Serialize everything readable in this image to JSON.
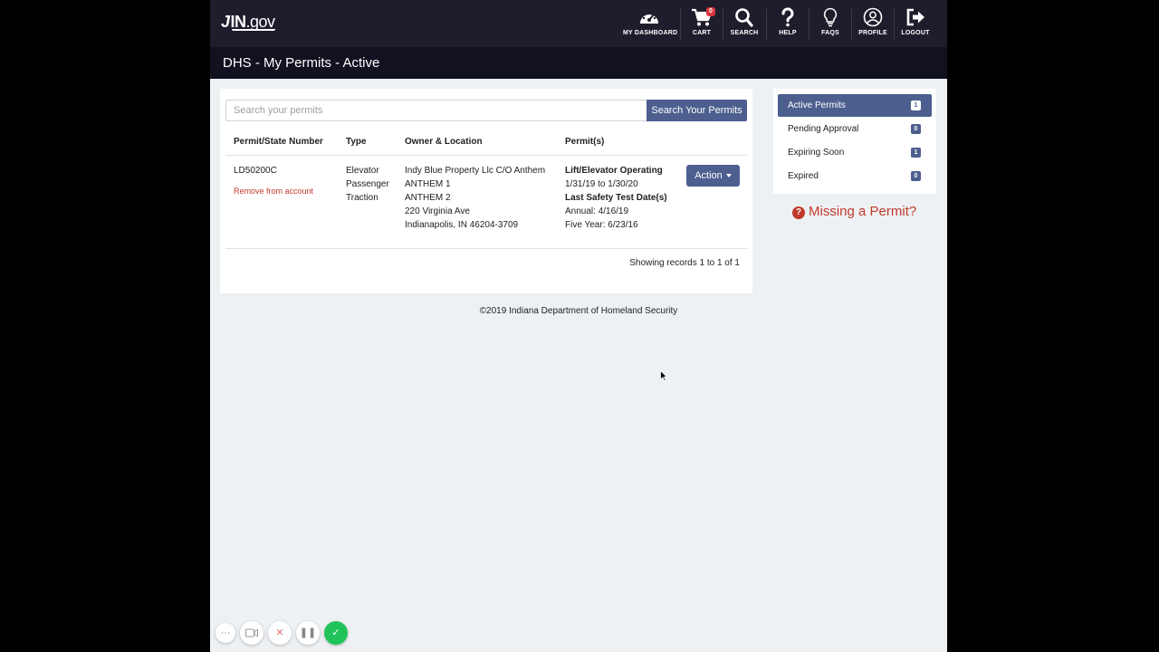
{
  "logo": {
    "mark": "J",
    "text": "IN",
    "dot": ".gov"
  },
  "nav": {
    "items": [
      {
        "label": "MY DASHBOARD",
        "icon": "dashboard-icon"
      },
      {
        "label": "CART",
        "icon": "cart-icon",
        "badge": "0"
      },
      {
        "label": "SEARCH",
        "icon": "search-icon"
      },
      {
        "label": "HELP",
        "icon": "help-icon"
      },
      {
        "label": "FAQS",
        "icon": "lightbulb-icon"
      },
      {
        "label": "PROFILE",
        "icon": "profile-icon"
      },
      {
        "label": "LOGOUT",
        "icon": "logout-icon"
      }
    ]
  },
  "page": {
    "title": "DHS - My Permits - Active"
  },
  "search": {
    "placeholder": "Search your permits",
    "button_label": "Search Your Permits"
  },
  "table": {
    "headers": [
      "Permit/State Number",
      "Type",
      "Owner & Location",
      "Permit(s)"
    ],
    "row": {
      "permit_number": "LD50200C",
      "remove_link": "Remove from account",
      "type": [
        "Elevator",
        "Passenger",
        "Traction"
      ],
      "owner_location": [
        "Indy Blue Property Llc C/O Anthem",
        "ANTHEM 1",
        "ANTHEM 2",
        "220 Virginia Ave",
        "Indianapolis, IN 46204-3709"
      ],
      "permit_title": "Lift/Elevator Operating",
      "permit_dates": "1/31/19 to 1/30/20",
      "safety_title": "Last Safety Test Date(s)",
      "annual": "Annual: 4/16/19",
      "five_year": "Five Year: 6/23/16",
      "action_label": "Action"
    },
    "records_info": "Showing records 1 to 1 of 1"
  },
  "sidebar": {
    "items": [
      {
        "label": "Active Permits",
        "count": "1",
        "active": true
      },
      {
        "label": "Pending Approval",
        "count": "0"
      },
      {
        "label": "Expiring Soon",
        "count": "1"
      },
      {
        "label": "Expired",
        "count": "0"
      }
    ],
    "missing_link": "Missing a Permit?",
    "missing_icon": "?"
  },
  "footer": {
    "text": "©2019 Indiana Department of Homeland Security"
  },
  "recorder": {
    "more": "···",
    "stop": "✕",
    "pause": "❚❚",
    "done": "✓"
  },
  "colors": {
    "nav_bg": "#1f1d2c",
    "title_bg": "#121120",
    "accent": "#4c5f8f",
    "danger": "#c0392b",
    "success": "#1fc35a"
  }
}
